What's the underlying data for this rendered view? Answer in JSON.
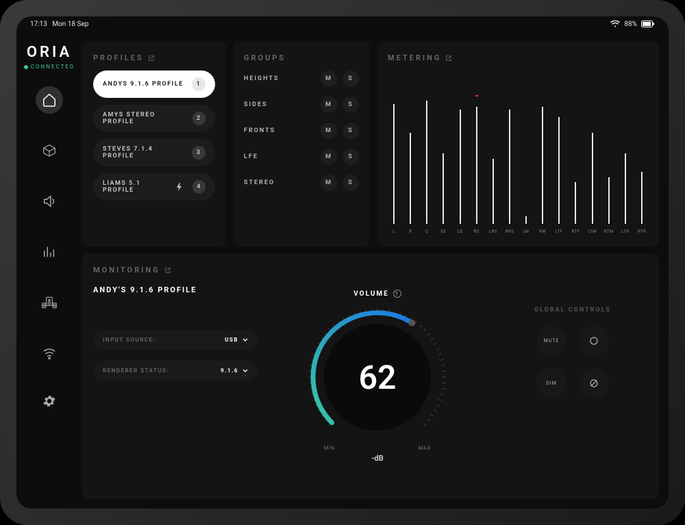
{
  "status": {
    "time": "17:13",
    "date": "Mon 18 Sep",
    "battery": "88%"
  },
  "brand": {
    "name": "ORIA",
    "connection": "CONNECTED"
  },
  "nav": {
    "items": [
      {
        "id": "home"
      },
      {
        "id": "room"
      },
      {
        "id": "sound"
      },
      {
        "id": "eq"
      },
      {
        "id": "speakers"
      },
      {
        "id": "network"
      }
    ],
    "settings": {
      "id": "settings"
    }
  },
  "profiles": {
    "title": "PROFILES",
    "items": [
      {
        "label": "ANDYS 9.1.6 PROFILE",
        "badge": "1",
        "active": true,
        "bolt": false
      },
      {
        "label": "AMYS STEREO PROFILE",
        "badge": "2",
        "active": false,
        "bolt": false
      },
      {
        "label": "STEVES 7.1.4 PROFILE",
        "badge": "3",
        "active": false,
        "bolt": false
      },
      {
        "label": "LIAMS 5.1 PROFILE",
        "badge": "4",
        "active": false,
        "bolt": true
      }
    ]
  },
  "groups": {
    "title": "GROUPS",
    "mute_label": "M",
    "solo_label": "S",
    "items": [
      {
        "label": "HEIGHTS"
      },
      {
        "label": "SIDES"
      },
      {
        "label": "FRONTS"
      },
      {
        "label": "LFE"
      },
      {
        "label": "STEREO"
      }
    ]
  },
  "metering": {
    "title": "METERING",
    "channels": [
      {
        "label": "L",
        "value": 92,
        "peak": false
      },
      {
        "label": "R",
        "value": 70,
        "peak": false
      },
      {
        "label": "C",
        "value": 95,
        "peak": false
      },
      {
        "label": "EE",
        "value": 54,
        "peak": false
      },
      {
        "label": "LS",
        "value": 88,
        "peak": false
      },
      {
        "label": "RS",
        "value": 90,
        "peak": true
      },
      {
        "label": "LRS",
        "value": 50,
        "peak": false
      },
      {
        "label": "RRS",
        "value": 88,
        "peak": false
      },
      {
        "label": "LW",
        "value": 6,
        "peak": false
      },
      {
        "label": "RW",
        "value": 90,
        "peak": false
      },
      {
        "label": "LTF",
        "value": 82,
        "peak": false
      },
      {
        "label": "RTF",
        "value": 32,
        "peak": false
      },
      {
        "label": "LTM",
        "value": 70,
        "peak": false
      },
      {
        "label": "RTM",
        "value": 36,
        "peak": false
      },
      {
        "label": "LTR",
        "value": 54,
        "peak": false
      },
      {
        "label": "RTR",
        "value": 40,
        "peak": false
      }
    ]
  },
  "monitoring": {
    "title": "MONITORING",
    "profile_name": "ANDY'S 9.1.6 PROFILE",
    "input_source_label": "INPUT SOURCE:",
    "input_source_value": "USB",
    "renderer_label": "RENDERER STATUS:",
    "renderer_value": "9.1.6"
  },
  "volume": {
    "title": "VOLUME",
    "value": "62",
    "min_label": "MIN",
    "max_label": "MAX",
    "unit": "-dB"
  },
  "globals": {
    "title": "GLOBAL CONTROLS",
    "mute_label": "MUTE",
    "dim_label": "DIM"
  },
  "colors": {
    "accent_teal": "#39c6a3",
    "accent_blue": "#1b79e5",
    "panel": "#141414"
  }
}
